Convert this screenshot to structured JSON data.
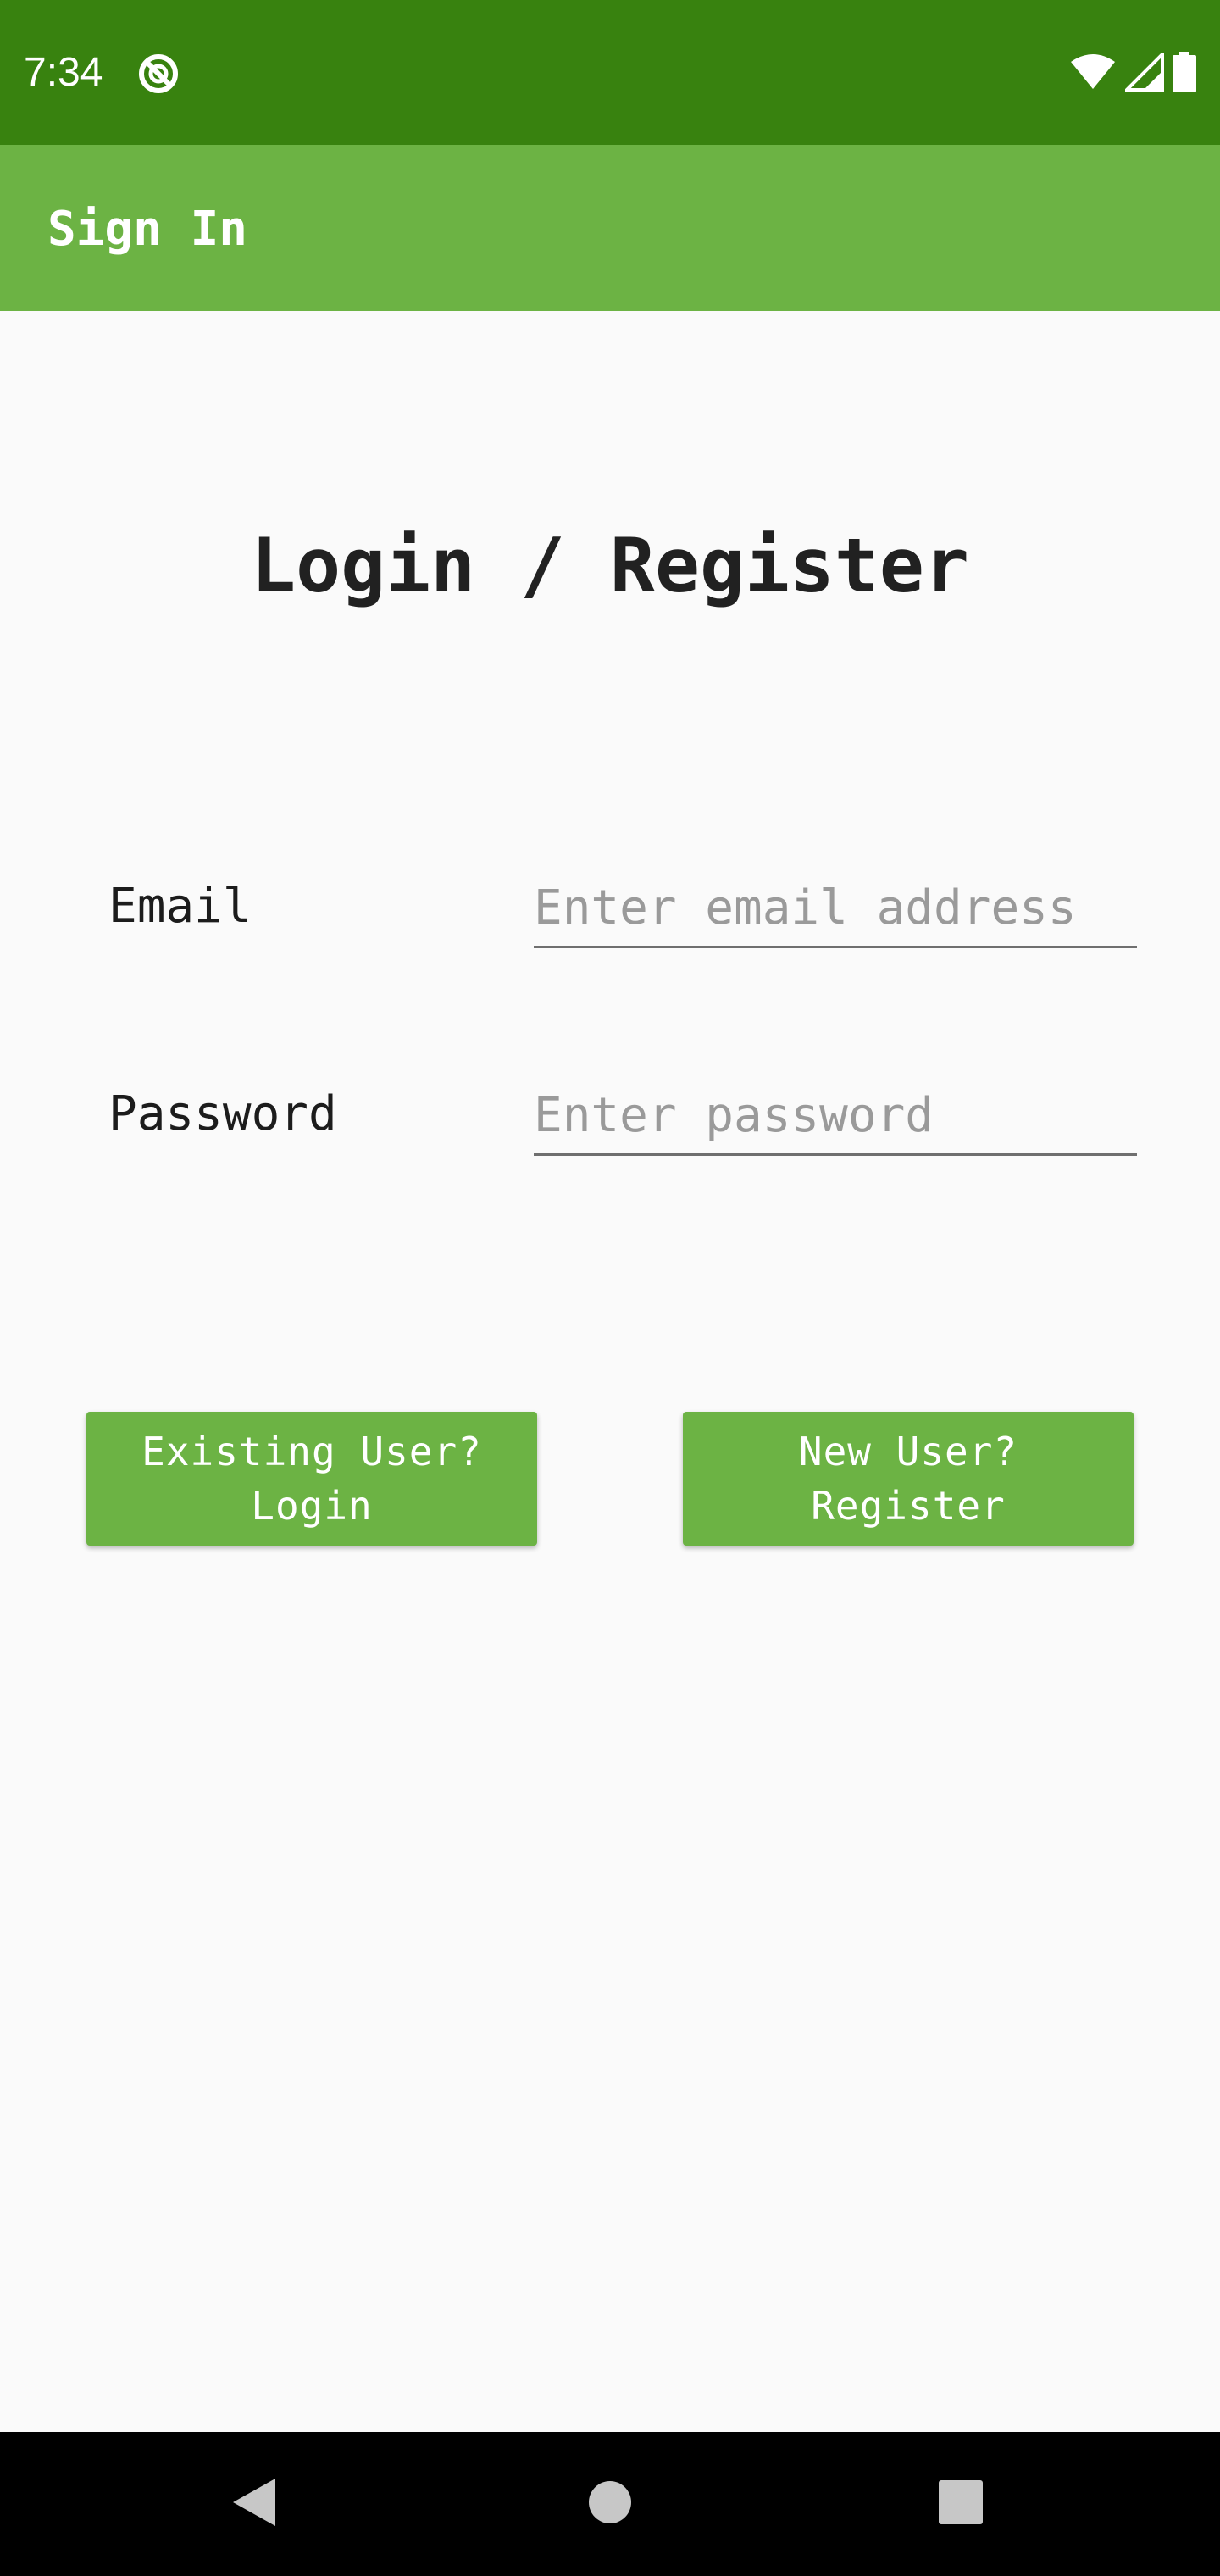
{
  "status_bar": {
    "time": "7:34",
    "app_icon": "circle-slash-icon",
    "right_icons": [
      "wifi-icon",
      "cell-signal-icon",
      "battery-icon"
    ]
  },
  "app_bar": {
    "title": "Sign In"
  },
  "main": {
    "heading": "Login / Register",
    "email": {
      "label": "Email",
      "value": "",
      "placeholder": "Enter email address"
    },
    "password": {
      "label": "Password",
      "value": "",
      "placeholder": "Enter password"
    },
    "buttons": {
      "login": {
        "line1": "Existing User?",
        "line2": "Login"
      },
      "register": {
        "line1": "New User?",
        "line2": "Register"
      }
    }
  },
  "nav_bar": {
    "icons": [
      "back-icon",
      "home-icon",
      "recents-icon"
    ]
  },
  "colors": {
    "status_bar": "#38820f",
    "app_bar": "#6cb344",
    "button": "#6cb344",
    "background": "#fafafa",
    "text": "#212121",
    "placeholder": "#9a9a9a"
  }
}
